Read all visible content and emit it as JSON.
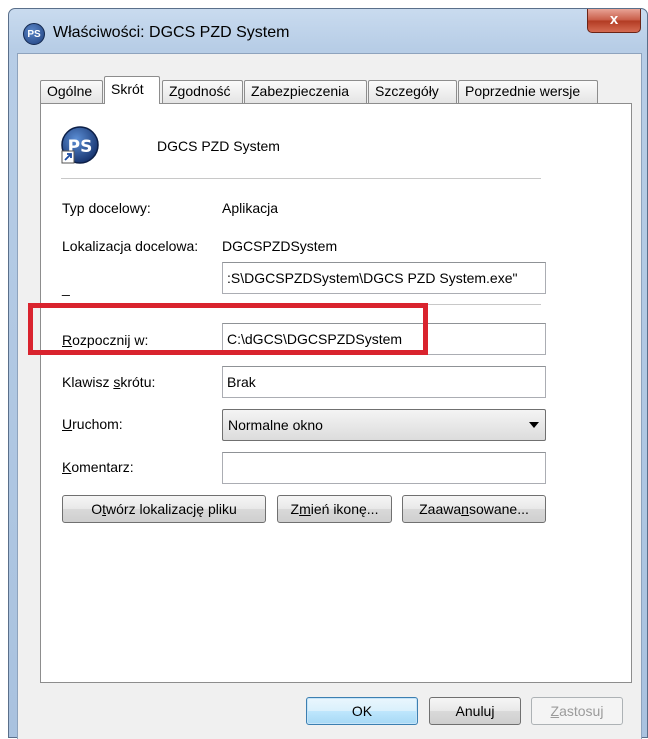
{
  "window": {
    "title": "Właściwości: DGCS PZD System",
    "close_label": "x",
    "small_icon_text": "PS"
  },
  "tabs": [
    {
      "label": "Ogólne"
    },
    {
      "label": "Skrót"
    },
    {
      "label": "Zgodność"
    },
    {
      "label": "Zabezpieczenia"
    },
    {
      "label": "Szczegóły"
    },
    {
      "label": "Poprzednie wersje"
    }
  ],
  "header": {
    "name": "DGCS PZD System",
    "icon_text": "PS"
  },
  "fields": {
    "target_type_label": "Typ docelowy:",
    "target_type_value": "Aplikacja",
    "target_location_label": "Lokalizacja docelowa:",
    "target_location_value": "DGCSPZDSystem",
    "target_label": "_",
    "target_value": ":S\\DGCSPZDSystem\\DGCS PZD System.exe\"",
    "start_in_label": "Rozpocznij w:",
    "start_in_value": "C:\\dGCS\\DGCSPZDSystem",
    "shortcut_key_label": "Klawisz skrótu:",
    "shortcut_key_value": "Brak",
    "run_label": "Uruchom:",
    "run_value": "Normalne okno",
    "comment_label": "Komentarz:",
    "comment_value": ""
  },
  "buttons": {
    "open_location": "Otwórz lokalizację pliku",
    "change_icon": "Zmień ikonę...",
    "advanced": "Zaawansowane...",
    "ok": "OK",
    "cancel": "Anuluj",
    "apply": "Zastosuj"
  },
  "colors": {
    "highlight": "#d9232e",
    "accent": "#3c7fb1"
  }
}
